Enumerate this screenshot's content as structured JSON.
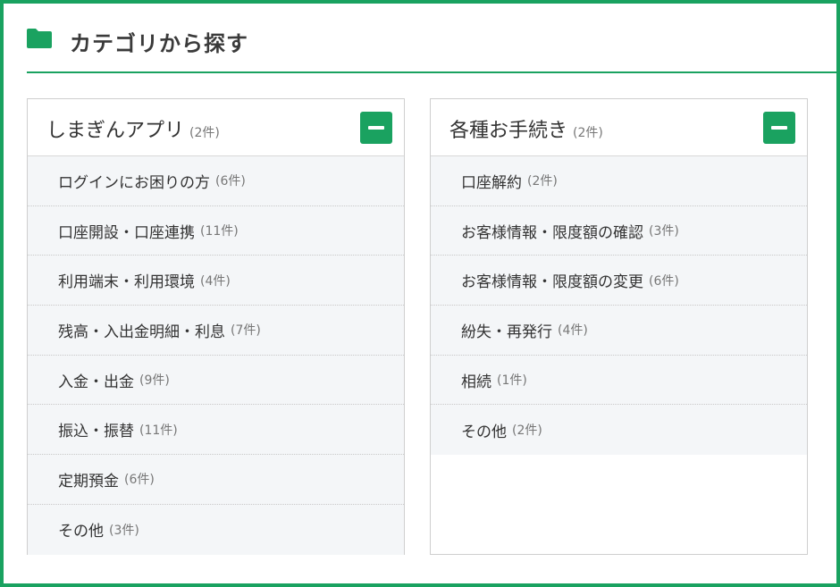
{
  "header": {
    "title": "カテゴリから探す",
    "icon": "folder-icon"
  },
  "colors": {
    "accent": "#1aa260",
    "item_bg": "#f4f6f8"
  },
  "panels": [
    {
      "title": "しまぎんアプリ",
      "count": "(2件)",
      "items": [
        {
          "label": "ログインにお困りの方",
          "count": "(6件)"
        },
        {
          "label": "口座開設・口座連携",
          "count": "(11件)"
        },
        {
          "label": "利用端末・利用環境",
          "count": "(4件)"
        },
        {
          "label": "残高・入出金明細・利息",
          "count": "(7件)"
        },
        {
          "label": "入金・出金",
          "count": "(9件)"
        },
        {
          "label": "振込・振替",
          "count": "(11件)"
        },
        {
          "label": "定期預金",
          "count": "(6件)"
        },
        {
          "label": "その他",
          "count": "(3件)"
        }
      ]
    },
    {
      "title": "各種お手続き",
      "count": "(2件)",
      "items": [
        {
          "label": "口座解約",
          "count": "(2件)"
        },
        {
          "label": "お客様情報・限度額の確認",
          "count": "(3件)"
        },
        {
          "label": "お客様情報・限度額の変更",
          "count": "(6件)"
        },
        {
          "label": "紛失・再発行",
          "count": "(4件)"
        },
        {
          "label": "相続",
          "count": "(1件)"
        },
        {
          "label": "その他",
          "count": "(2件)"
        }
      ]
    }
  ]
}
